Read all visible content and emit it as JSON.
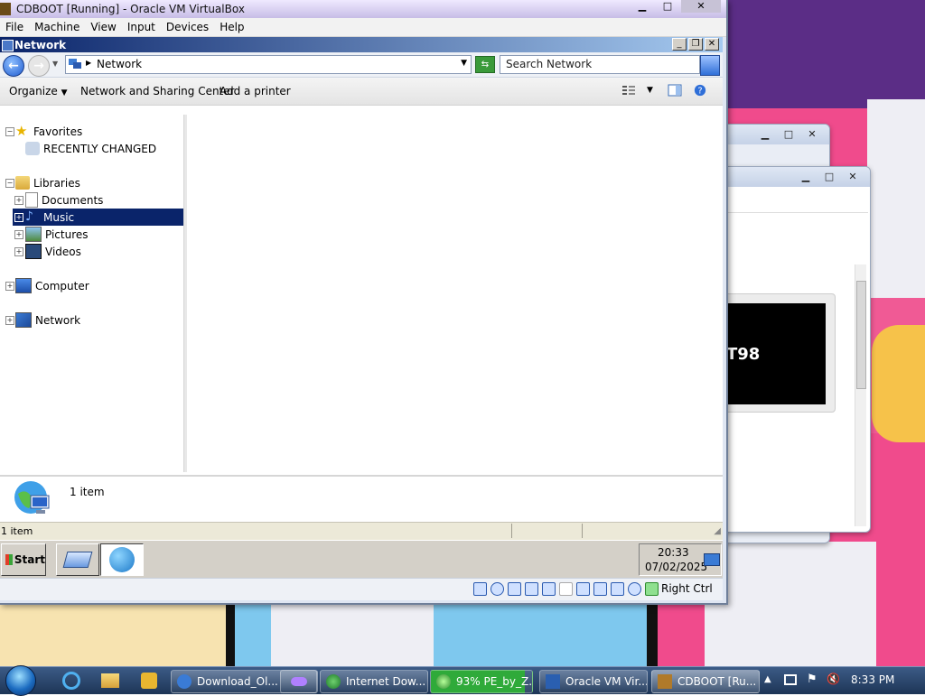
{
  "host": {
    "vbox_title": "CDBOOT [Running] - Oracle VM VirtualBox",
    "vbox_menu": [
      "File",
      "Machine",
      "View",
      "Input",
      "Devices",
      "Help"
    ],
    "bg_window_text": "T98",
    "host_key": "Right Ctrl",
    "taskbar": {
      "items": [
        {
          "label": "Download_Ol...",
          "icon": "ie-page-icon"
        },
        {
          "label": "",
          "icon": "mask-app-icon"
        },
        {
          "label": "Internet Dow...",
          "icon": "globe-download-icon"
        },
        {
          "label": "93% PE_by_Z...",
          "icon": "download-progress-icon"
        },
        {
          "label": "Oracle VM Vir...",
          "icon": "virtualbox-icon"
        },
        {
          "label": "CDBOOT [Ru...",
          "icon": "virtualbox-vm-icon"
        }
      ],
      "download_progress": 0.93,
      "clock": "8:33 PM"
    }
  },
  "guest": {
    "window_title": "Network",
    "address": "Network",
    "search_placeholder": "Search Network",
    "toolbar": {
      "organize": "Organize",
      "network_sharing": "Network and Sharing Center",
      "add_printer": "Add a printer"
    },
    "nav": {
      "favorites": "Favorites",
      "recently_changed": "RECENTLY CHANGED",
      "libraries": "Libraries",
      "documents": "Documents",
      "music": "Music",
      "pictures": "Pictures",
      "videos": "Videos",
      "computer": "Computer",
      "network": "Network"
    },
    "details_count": "1 item",
    "status_text": "1 item",
    "start_label": "Start",
    "tray_time": "20:33",
    "tray_date": "07/02/2025"
  }
}
